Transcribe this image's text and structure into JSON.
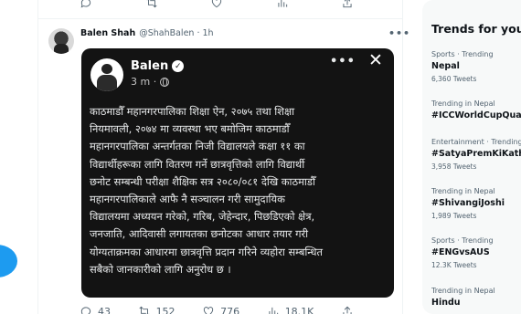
{
  "prev_tweet_actions": {
    "reply_count": "",
    "retweet_count": "",
    "like_count": "",
    "views_count": ""
  },
  "tweet": {
    "author_name": "Balen Shah",
    "author_handle": "@ShahBalen",
    "separator": "·",
    "time": "1h",
    "more_glyph": "•••"
  },
  "embedded_post": {
    "author_name": "Balen",
    "verified_glyph": "✓",
    "time": "3 m ·",
    "more_glyph": "•••",
    "close_glyph": "✕",
    "text_lines": [
      "काठमाडौँ महानगरपालिका शिक्षा ऐन, २०७५ तथा शिक्षा",
      "नियमावली, २०७४ मा व्यवस्था भए बमोजिम काठमाडौँ",
      "महानगरपालिका अन्तर्गतका निजी विद्यालयले कक्षा ११ का",
      "विद्यार्थीहरूका लागि वितरण गर्ने छात्रवृत्तिको लागि विद्यार्थी",
      "छनोट सम्बन्धी परीक्षा शैक्षिक सत्र २०८०/०८१ देखि काठमाडौँ",
      "महानगरपालिकाले आफै नै सञ्चालन गरी सामुदायिक",
      "विद्यालयमा अध्ययन गरेको, गरिब, जेहेन्दार, पिछडिएको क्षेत्र,",
      "जनजाति, आदिवासी लगायतका छनोटका आधार तयार गरी",
      "योग्यताक्रमका आधारमा छात्रवृत्ति प्रदान गरिने व्यहोरा सम्बन्धित",
      "सबैको जानकारीको लागि अनुरोध छ ।"
    ]
  },
  "tweet_actions": {
    "reply_count": "43",
    "retweet_count": "152",
    "like_count": "776",
    "views_count": "18.1K"
  },
  "trends": {
    "title": "Trends for you",
    "items": [
      {
        "meta": "Sports · Trending",
        "name": "Nepal",
        "count": "6,360 Tweets"
      },
      {
        "meta": "Trending in Nepal",
        "name": "#ICCWorldCupQualifier",
        "count": ""
      },
      {
        "meta": "Entertainment · Trending",
        "name": "#SatyaPremKiKatha",
        "count": "3,958 Tweets"
      },
      {
        "meta": "Trending in Nepal",
        "name": "#ShivangiJoshi",
        "count": "1,989 Tweets"
      },
      {
        "meta": "Sports · Trending",
        "name": "#ENGvsAUS",
        "count": "12.3K Tweets"
      },
      {
        "meta": "Trending in Nepal",
        "name": "Hindu",
        "count": ""
      }
    ]
  },
  "colors": {
    "accent": "#1d9bf0",
    "media_bg": "#131313",
    "muted_text": "#536471"
  }
}
